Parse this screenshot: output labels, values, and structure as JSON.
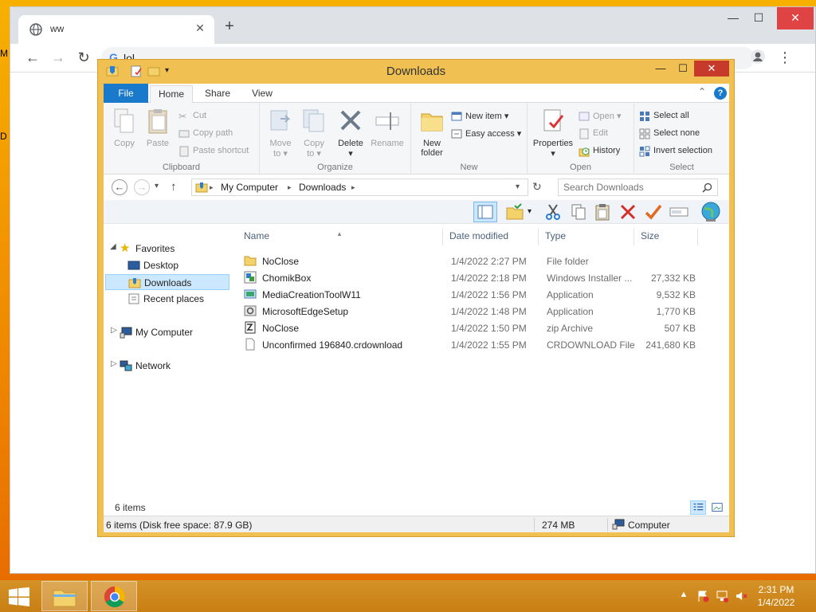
{
  "chrome": {
    "tab_title": "ww",
    "omnibox_text": "lol"
  },
  "explorer": {
    "title": "Downloads",
    "ribbon_tabs": [
      "File",
      "Home",
      "Share",
      "View"
    ],
    "help": "?",
    "ribbon": {
      "clipboard": {
        "label": "Clipboard",
        "copy": "Copy",
        "paste": "Paste",
        "cut": "Cut",
        "copy_path": "Copy path",
        "paste_shortcut": "Paste shortcut"
      },
      "organize": {
        "label": "Organize",
        "move_to_1": "Move",
        "move_to_2": "to ▾",
        "copy_to_1": "Copy",
        "copy_to_2": "to ▾",
        "delete": "Delete",
        "delete_arrow": "▾",
        "rename": "Rename"
      },
      "new": {
        "label": "New",
        "new_folder_1": "New",
        "new_folder_2": "folder",
        "new_item": "New item ▾",
        "easy_access": "Easy access ▾"
      },
      "open": {
        "label": "Open",
        "properties": "Properties",
        "properties_arrow": "▾",
        "open": "Open ▾",
        "edit": "Edit",
        "history": "History"
      },
      "select": {
        "label": "Select",
        "select_all": "Select all",
        "select_none": "Select none",
        "invert_selection": "Invert selection"
      }
    },
    "address": {
      "crumbs": [
        "My Computer",
        "Downloads"
      ],
      "search_placeholder": "Search Downloads"
    },
    "nav": {
      "favorites": "Favorites",
      "desktop": "Desktop",
      "downloads": "Downloads",
      "recent_places": "Recent places",
      "my_computer": "My Computer",
      "network": "Network"
    },
    "columns": {
      "name": "Name",
      "date": "Date modified",
      "type": "Type",
      "size": "Size"
    },
    "files": [
      {
        "name": "NoClose",
        "date": "1/4/2022 2:27 PM",
        "type": "File folder",
        "size": "",
        "icon": "folder-icon"
      },
      {
        "name": "ChomikBox",
        "date": "1/4/2022 2:18 PM",
        "type": "Windows Installer ...",
        "size": "27,332 KB",
        "icon": "installer-icon"
      },
      {
        "name": "MediaCreationToolW11",
        "date": "1/4/2022 1:56 PM",
        "type": "Application",
        "size": "9,532 KB",
        "icon": "app-icon"
      },
      {
        "name": "MicrosoftEdgeSetup",
        "date": "1/4/2022 1:48 PM",
        "type": "Application",
        "size": "1,770 KB",
        "icon": "setup-icon"
      },
      {
        "name": "NoClose",
        "date": "1/4/2022 1:50 PM",
        "type": "zip Archive",
        "size": "507 KB",
        "icon": "zip-icon"
      },
      {
        "name": "Unconfirmed 196840.crdownload",
        "date": "1/4/2022 1:55 PM",
        "type": "CRDOWNLOAD File",
        "size": "241,680 KB",
        "icon": "file-icon"
      }
    ],
    "item_count": "6 items",
    "status": {
      "disk": "6 items (Disk free space: 87.9 GB)",
      "size": "274 MB",
      "location": "Computer"
    }
  },
  "taskbar": {
    "time": "2:31 PM",
    "date": "1/4/2022"
  },
  "colors": {
    "desktop": "#f6a800",
    "explorer_frame": "#f0c052",
    "ribbon_file_tab": "#1979ca",
    "selection": "#cce8ff",
    "chrome_close": "#e04343"
  }
}
